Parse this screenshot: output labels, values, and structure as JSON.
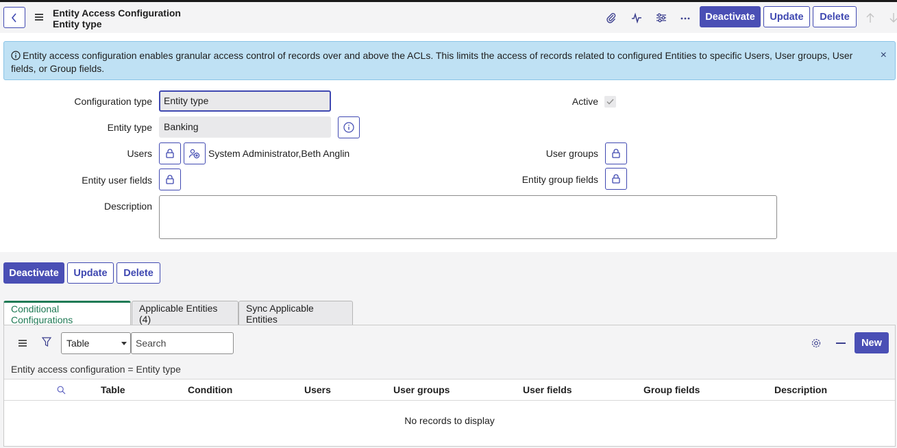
{
  "header": {
    "title": "Entity Access Configuration",
    "subtitle": "Entity type",
    "icons": [
      "back-icon",
      "menu-icon",
      "paperclip-icon",
      "activity-icon",
      "settings-sliders-icon",
      "more-icon",
      "arrow-up-icon",
      "arrow-down-icon"
    ],
    "deactivate_label": "Deactivate",
    "update_label": "Update",
    "delete_label": "Delete"
  },
  "banner": {
    "icon": "info-icon",
    "text": "Entity access configuration enables granular access control of records over and above the ACLs. This limits the access of records related to configured Entities to specific Users, User groups, User fields, or Group fields.",
    "close": "×"
  },
  "form": {
    "configuration_type_label": "Configuration type",
    "configuration_type_value": "Entity type",
    "entity_type_label": "Entity type",
    "entity_type_value": "Banking",
    "users_label": "Users",
    "users_value": "System Administrator,Beth Anglin",
    "entity_user_fields_label": "Entity user fields",
    "description_label": "Description",
    "description_value": "",
    "active_label": "Active",
    "active_checked": true,
    "user_groups_label": "User groups",
    "entity_group_fields_label": "Entity group fields"
  },
  "actions": {
    "deactivate_label": "Deactivate",
    "update_label": "Update",
    "delete_label": "Delete"
  },
  "tabs": [
    {
      "label": "Conditional Configurations",
      "active": true
    },
    {
      "label": "Applicable Entities (4)",
      "active": false
    },
    {
      "label": "Sync Applicable Entities",
      "active": false
    }
  ],
  "list": {
    "select_value": "Table",
    "search_placeholder": "Search",
    "new_label": "New",
    "filter_text": "Entity access configuration = Entity type",
    "columns": [
      "Table",
      "Condition",
      "Users",
      "User groups",
      "User fields",
      "Group fields",
      "Description"
    ],
    "empty_text": "No records to display"
  },
  "colors": {
    "primary": "#4a4fb5",
    "banner_bg": "#bfe1f4",
    "active_tab": "#1f7a55"
  }
}
